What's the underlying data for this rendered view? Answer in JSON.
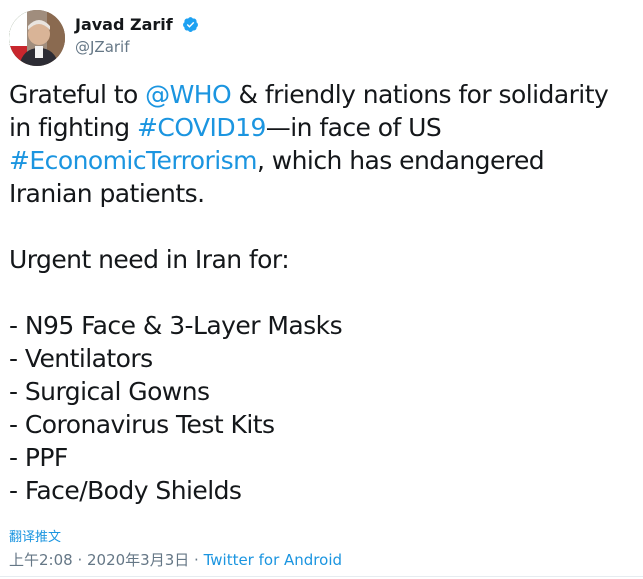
{
  "author": {
    "name": "Javad Zarif",
    "handle": "@JZarif",
    "verified": true,
    "avatar_icon": "profile-photo-icon"
  },
  "tweet": {
    "line1": {
      "pre": "Grateful to ",
      "mention": "@WHO",
      "post": " & friendly nations for solidarity"
    },
    "line2": {
      "pre": "in fighting ",
      "hashtag": "#COVID19",
      "post": "—in face of US"
    },
    "line3": {
      "hashtag": "#EconomicTerrorism",
      "post": ", which has endangered"
    },
    "line4": "Iranian patients.",
    "urgent_heading": "Urgent need in Iran for:",
    "items": [
      "- N95 Face & 3-Layer Masks",
      "- Ventilators",
      "- Surgical Gowns",
      "- Coronavirus Test Kits",
      "- PPF",
      "- Face/Body Shields"
    ]
  },
  "translate_label": "翻译推文",
  "meta": {
    "time": "上午2:08",
    "separator": " · ",
    "date": "2020年3月3日",
    "source": "Twitter for Android"
  },
  "colors": {
    "link": "#1b95e0",
    "text": "#14171a",
    "secondary": "#657786",
    "verified_badge": "#1da1f2"
  }
}
